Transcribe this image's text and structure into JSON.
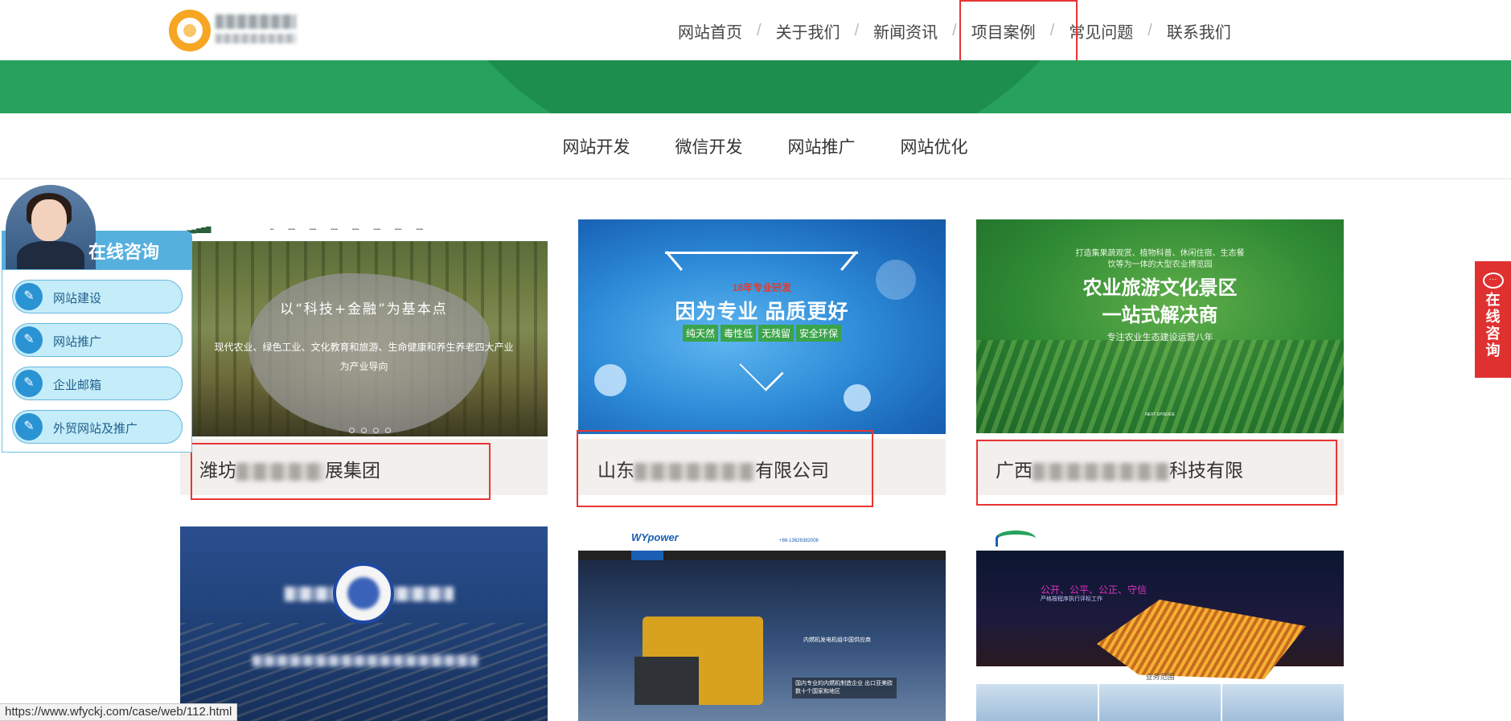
{
  "header": {
    "nav": [
      {
        "label": "网站首页"
      },
      {
        "label": "关于我们"
      },
      {
        "label": "新闻资讯"
      },
      {
        "label": "项目案例"
      },
      {
        "label": "常见问题"
      },
      {
        "label": "联系我们"
      }
    ],
    "separator": "/"
  },
  "subnav": [
    {
      "label": "网站开发"
    },
    {
      "label": "微信开发"
    },
    {
      "label": "网站推广"
    },
    {
      "label": "网站优化"
    }
  ],
  "cases": [
    {
      "title_prefix": "潍坊",
      "title_suffix": "展集团",
      "thumb": {
        "heading": "以“科技+金融”为基本点",
        "sub": "现代农业、绿色工业、文化教育和旅游、生命健康和养生养老四大产业为产业导向"
      }
    },
    {
      "title_prefix": "山东",
      "title_suffix": "有限公司",
      "thumb": {
        "badge": "18年专业研发",
        "heading": "因为专业 品质更好",
        "tags": [
          "纯天然",
          "毒性低",
          "无残留",
          "安全环保"
        ]
      }
    },
    {
      "title_prefix": "广西",
      "title_suffix": "科技有限",
      "thumb": {
        "top": "打造集果蔬观赏、植物科普、休闲住宿、生态餐饮等为一体的大型农业博览园",
        "heading_line1": "农业旅游文化景区",
        "heading_line2": "一站式解决商",
        "sub": "专注农业生态建设运营八年",
        "small": "NEXT EPISODE"
      }
    },
    {
      "thumb": {}
    },
    {
      "thumb": {
        "logo": "WYpower",
        "phone": "+86-13626382006",
        "text1": "内燃机发电机组中国供应商",
        "text2": "国内专业的内燃机制造企业 出口亚美欧数十个国家和地区"
      }
    },
    {
      "thumb": {
        "slogan": "公开、公平、公正、守信",
        "slogan_sub": "严格按程序执行评标工作",
        "section": "业务范围"
      }
    }
  ],
  "consult": {
    "title": "在线咨询",
    "buttons": [
      {
        "label": "网站建设"
      },
      {
        "label": "网站推广"
      },
      {
        "label": "企业邮箱"
      },
      {
        "label": "外贸网站及推广"
      }
    ]
  },
  "side_consult": {
    "label": "在线咨询"
  },
  "statusbar": {
    "url": "https://www.wfyckj.com/case/web/112.html"
  },
  "colors": {
    "brand_green": "#27a25d",
    "highlight_red": "#e83535",
    "consult_blue": "#56b0de",
    "side_red": "#e03131"
  }
}
